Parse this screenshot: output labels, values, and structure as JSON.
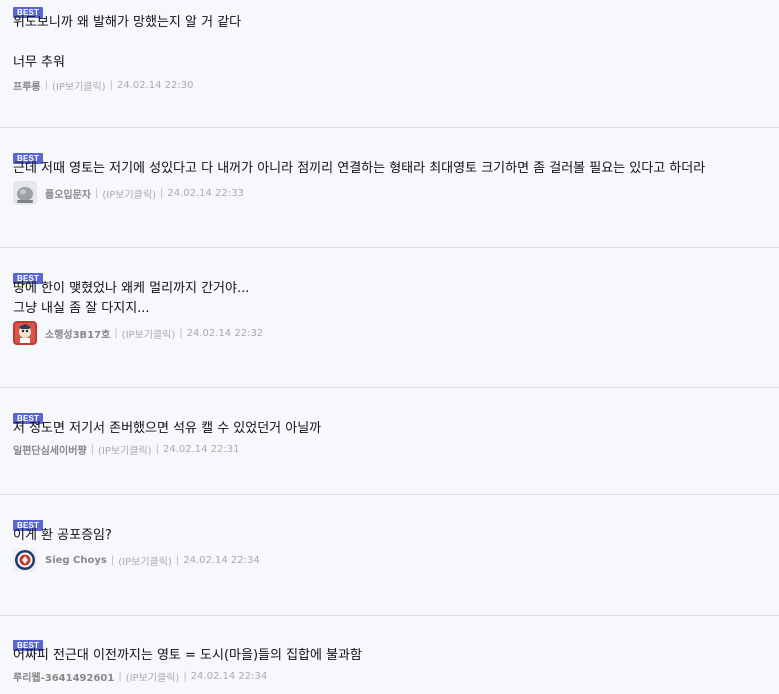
{
  "badge_label": "BEST",
  "separator": "|",
  "comments": [
    {
      "text": "위도보니까 왜 발해가 망했는지 알 거 같다\n\n너무 추워",
      "author": "프루롱",
      "ip_label": "(IP보기클릭)",
      "timestamp": "24.02.14 22:30",
      "avatar": null
    },
    {
      "text": "근데 저때 영토는 저기에 성있다고 다 내꺼가 아니라 점끼리 연결하는 형태라 최대영토 크기하면 좀 걸러볼 필요는 있다고 하더라",
      "author": "플오입문자",
      "ip_label": "(IP보기클릭)",
      "timestamp": "24.02.14 22:33",
      "avatar": "gray-blob-avatar"
    },
    {
      "text": "땅에 한이 맺혔었나 왜케 멀리까지 간거야...\n그냥 내실 좀 잘 다지지...",
      "author": "소행성3B17호",
      "ip_label": "(IP보기클릭)",
      "timestamp": "24.02.14 22:32",
      "avatar": "red-character-avatar"
    },
    {
      "text": "저 정도면 저기서 존버했으면 석유 캘 수 있었던거 아닐까",
      "author": "일편단심세이버쨩",
      "ip_label": "(IP보기클릭)",
      "timestamp": "24.02.14 22:31",
      "avatar": null
    },
    {
      "text": "이게 환 공포증임?",
      "author": "Sieg Choys",
      "ip_label": "(IP보기클릭)",
      "timestamp": "24.02.14 22:34",
      "avatar": "circle-emblem-avatar"
    },
    {
      "text": "어짜피 전근대 이전까지는 영토 = 도시(마을)들의 집합에 불과함",
      "author": "루리웹-3641492601",
      "ip_label": "(IP보기클릭)",
      "timestamp": "24.02.14 22:34",
      "avatar": null
    }
  ]
}
